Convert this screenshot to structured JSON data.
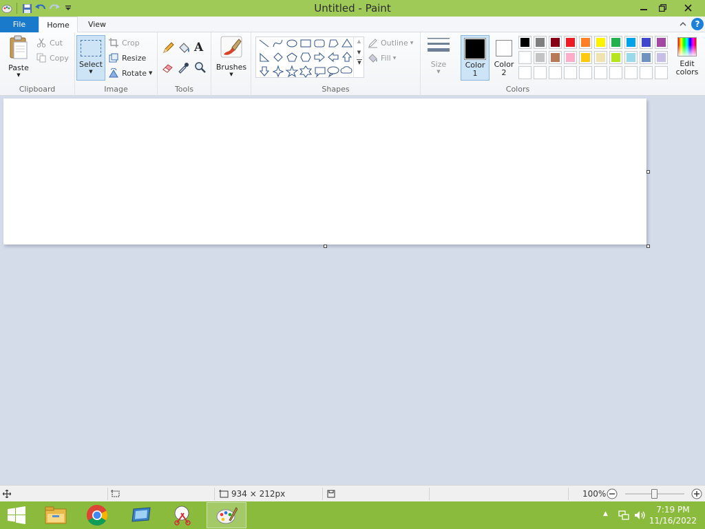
{
  "window": {
    "title": "Untitled - Paint"
  },
  "tabs": {
    "file": "File",
    "home": "Home",
    "view": "View"
  },
  "ribbon": {
    "clipboard": {
      "label": "Clipboard",
      "paste": "Paste",
      "cut": "Cut",
      "copy": "Copy"
    },
    "image": {
      "label": "Image",
      "select": "Select",
      "crop": "Crop",
      "resize": "Resize",
      "rotate": "Rotate"
    },
    "tools": {
      "label": "Tools"
    },
    "brushes": {
      "label": "Brushes"
    },
    "shapes": {
      "label": "Shapes",
      "outline": "Outline",
      "fill": "Fill"
    },
    "size": {
      "label": "Size"
    },
    "colors": {
      "label": "Colors",
      "color1": "Color",
      "color1_num": "1",
      "color2": "Color",
      "color2_num": "2",
      "edit": "Edit",
      "edit2": "colors",
      "color1_value": "#000000",
      "color2_value": "#ffffff",
      "palette_row1": [
        "#000000",
        "#7f7f7f",
        "#880015",
        "#ed1c24",
        "#ff7f27",
        "#fff200",
        "#22b14c",
        "#00a2e8",
        "#3f48cc",
        "#a349a4"
      ],
      "palette_row2": [
        "#ffffff",
        "#c3c3c3",
        "#b97a57",
        "#ffaec9",
        "#ffc90e",
        "#efe4b0",
        "#b5e61d",
        "#99d9ea",
        "#7092be",
        "#c8bfe7"
      ]
    }
  },
  "status": {
    "dimensions": "934 × 212px",
    "zoom": "100%"
  },
  "taskbar": {
    "time": "7:19 PM",
    "date": "11/16/2022"
  }
}
